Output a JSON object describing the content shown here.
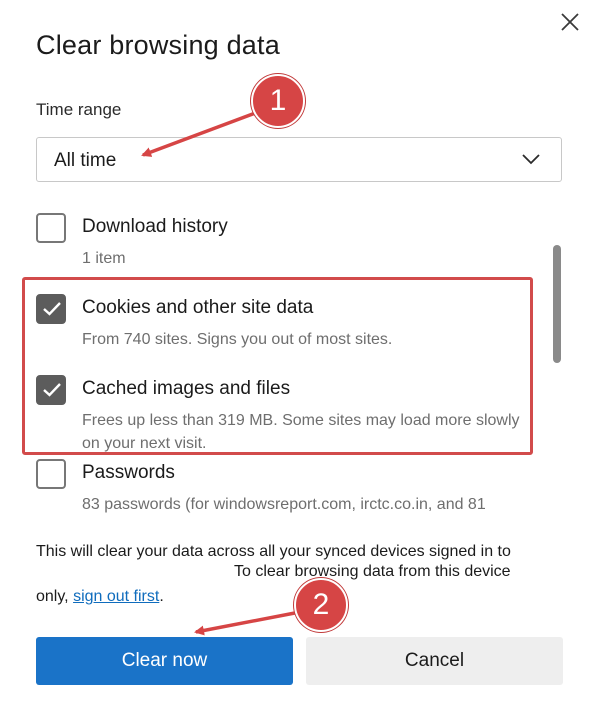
{
  "dialog": {
    "title": "Clear browsing data",
    "close_icon": "close-icon"
  },
  "time_range": {
    "label": "Time range",
    "selected": "All time"
  },
  "items": [
    {
      "title": "Download history",
      "description": "1 item",
      "checked": false
    },
    {
      "title": "Cookies and other site data",
      "description": "From 740 sites. Signs you out of most sites.",
      "checked": true
    },
    {
      "title": "Cached images and files",
      "description": "Frees up less than 319 MB. Some sites may load more slowly on your next visit.",
      "checked": true
    },
    {
      "title": "Passwords",
      "description": "83 passwords (for windowsreport.com, irctc.co.in, and 81",
      "checked": false
    }
  ],
  "sync_note": {
    "line1": "This will clear your data across all your synced devices signed in to",
    "line2": "To clear browsing data from this device",
    "line3_prefix": "only,",
    "link": "sign out first",
    "line3_suffix": "."
  },
  "buttons": {
    "primary": "Clear now",
    "secondary": "Cancel"
  },
  "annotations": {
    "badge1": "1",
    "badge2": "2",
    "color": "#d64545"
  },
  "colors": {
    "accent": "#1a73c8",
    "checkbox_checked": "#5c5c5c",
    "highlight": "#d24b4b",
    "link": "#0f6cbd"
  }
}
